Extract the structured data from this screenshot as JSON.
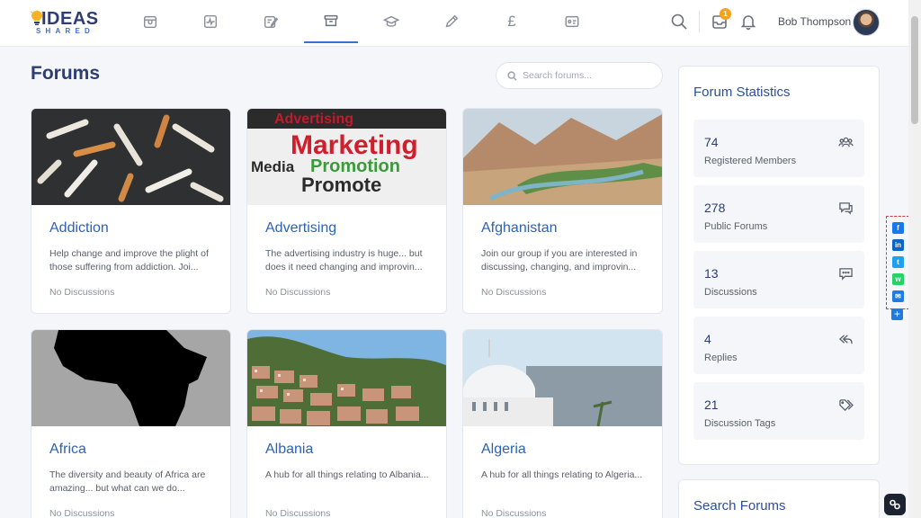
{
  "brand": {
    "word": "IDEAS",
    "sub": "SHARED"
  },
  "nav": {
    "items": [
      {
        "name": "nav-store-icon"
      },
      {
        "name": "nav-activity-icon"
      },
      {
        "name": "nav-edit-icon"
      },
      {
        "name": "nav-forums-icon",
        "active": true
      },
      {
        "name": "nav-education-icon"
      },
      {
        "name": "nav-pencil-icon"
      },
      {
        "name": "nav-pound-icon",
        "glyph": "£"
      },
      {
        "name": "nav-card-icon"
      }
    ]
  },
  "header": {
    "notification_count": "1",
    "user_name": "Bob Thompson"
  },
  "main": {
    "title": "Forums",
    "search_placeholder": "Search forums..."
  },
  "forums": [
    {
      "title": "Addiction",
      "description": "Help change and improve the plight of those suffering from addiction. Joi...",
      "meta": "No Discussions"
    },
    {
      "title": "Advertising",
      "description": "The advertising industry is huge... but does it need changing and improvin...",
      "meta": "No Discussions"
    },
    {
      "title": "Afghanistan",
      "description": "Join our group if you are interested in discussing, changing, and improvin...",
      "meta": "No Discussions"
    },
    {
      "title": "Africa",
      "description": "The diversity and beauty of Africa are amazing... but what can we do...",
      "meta": "No Discussions"
    },
    {
      "title": "Albania",
      "description": "A hub for all things relating to Albania...",
      "meta": "No Discussions"
    },
    {
      "title": "Algeria",
      "description": "A hub for all things relating to Algeria...",
      "meta": "No Discussions"
    }
  ],
  "advert_words": [
    "Advertising",
    "Marketing",
    "Media",
    "Promotion",
    "Promote"
  ],
  "sidebar": {
    "title": "Forum Statistics",
    "stats": [
      {
        "value": "74",
        "label": "Registered Members",
        "icon": "members-icon"
      },
      {
        "value": "278",
        "label": "Public Forums",
        "icon": "forums-icon"
      },
      {
        "value": "13",
        "label": "Discussions",
        "icon": "discussion-icon"
      },
      {
        "value": "4",
        "label": "Replies",
        "icon": "reply-icon"
      },
      {
        "value": "21",
        "label": "Discussion Tags",
        "icon": "tag-icon"
      }
    ],
    "search_title": "Search Forums"
  },
  "share": {
    "buttons": [
      {
        "name": "facebook-icon",
        "glyph": "f",
        "color": "#1877f2"
      },
      {
        "name": "linkedin-icon",
        "glyph": "in",
        "color": "#0a66c2"
      },
      {
        "name": "twitter-icon",
        "glyph": "t",
        "color": "#1da1f2"
      },
      {
        "name": "whatsapp-icon",
        "glyph": "w",
        "color": "#25d366"
      },
      {
        "name": "email-icon",
        "glyph": "✉",
        "color": "#1e7be0"
      }
    ],
    "more": "+"
  }
}
